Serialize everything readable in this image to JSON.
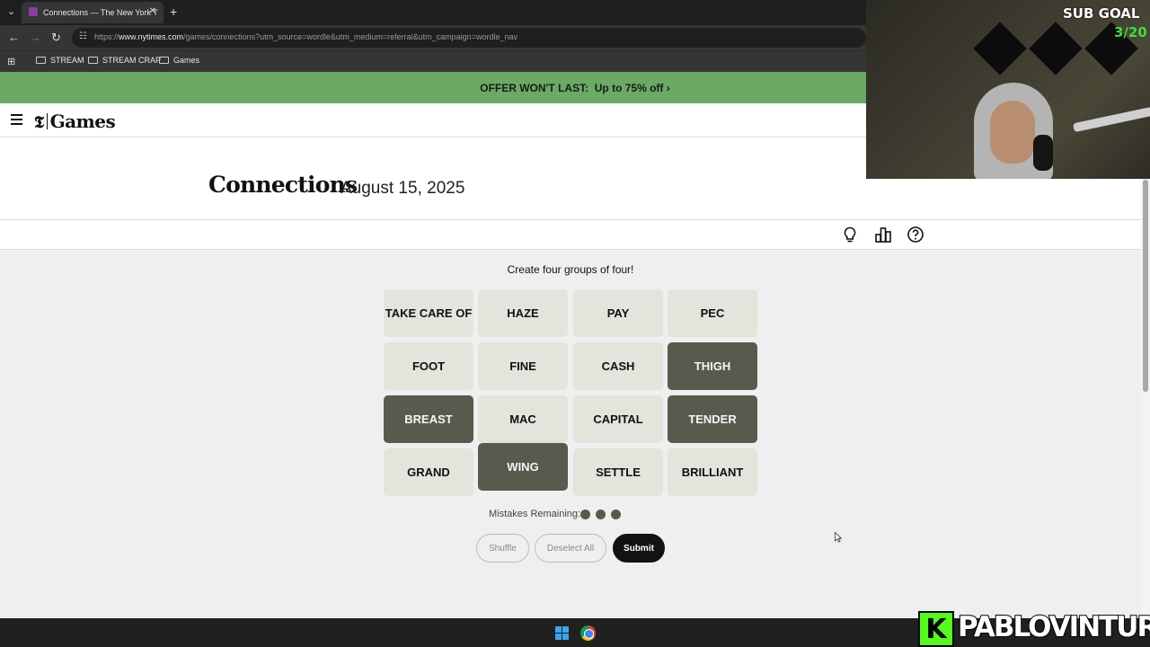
{
  "browser": {
    "tab_title": "Connections — The New York T",
    "url_prefix": "https://",
    "url_domain": "www.nytimes.com",
    "url_rest": "/games/connections?utm_source=wordle&utm_medium=referral&utm_campaign=wordle_nav",
    "bookmarks": [
      "STREAM",
      "STREAM CRAP",
      "Games"
    ]
  },
  "offer": {
    "text": "OFFER WON'T LAST:",
    "detail": "Up to 75% off ›"
  },
  "header": {
    "logo_t": "𝕿",
    "logo_text": "Games"
  },
  "game": {
    "title": "Connections",
    "date": "August 15, 2025",
    "instructions": "Create four groups of four!",
    "tiles": [
      {
        "word": "TAKE CARE OF",
        "selected": false
      },
      {
        "word": "HAZE",
        "selected": false
      },
      {
        "word": "PAY",
        "selected": false
      },
      {
        "word": "PEC",
        "selected": false
      },
      {
        "word": "FOOT",
        "selected": false
      },
      {
        "word": "FINE",
        "selected": false
      },
      {
        "word": "CASH",
        "selected": false
      },
      {
        "word": "THIGH",
        "selected": true
      },
      {
        "word": "BREAST",
        "selected": true
      },
      {
        "word": "MAC",
        "selected": false
      },
      {
        "word": "CAPITAL",
        "selected": false
      },
      {
        "word": "TENDER",
        "selected": true
      },
      {
        "word": "GRAND",
        "selected": false
      },
      {
        "word": "WING",
        "selected": true
      },
      {
        "word": "SETTLE",
        "selected": false
      },
      {
        "word": "BRILLIANT",
        "selected": false
      }
    ],
    "mistakes_label": "Mistakes Remaining:",
    "mistakes_remaining": 3,
    "buttons": {
      "shuffle": "Shuffle",
      "deselect": "Deselect All",
      "submit": "Submit"
    }
  },
  "overlay": {
    "sub_goal_label": "SUB GOAL",
    "sub_goal_count": "3/20",
    "kick_letter": "K",
    "streamer": "PABLOVINTURA"
  },
  "colors": {
    "selected_tile": "#5a594e",
    "tile": "#e4e3dc",
    "offer_banner": "#6aaa64"
  }
}
